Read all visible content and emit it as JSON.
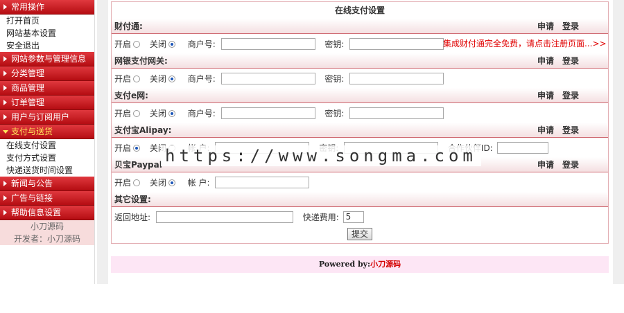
{
  "sidebar": {
    "groups": [
      {
        "label": "常用操作",
        "items": [
          "打开首页",
          "网站基本设置",
          "安全退出"
        ]
      },
      {
        "label": "网站参数与管理信息",
        "items": []
      },
      {
        "label": "分类管理",
        "items": []
      },
      {
        "label": "商品管理",
        "items": []
      },
      {
        "label": "订单管理",
        "items": []
      },
      {
        "label": "用户与订阅用户",
        "items": []
      },
      {
        "label": "支付与送货",
        "items": [
          "在线支付设置",
          "支付方式设置",
          "快递送货时间设置"
        ]
      },
      {
        "label": "新闻与公告",
        "items": []
      },
      {
        "label": "广告与链接",
        "items": []
      },
      {
        "label": "帮助信息设置",
        "items": []
      }
    ],
    "credit_line1": "小刀源码",
    "credit_line2": "开发者：小刀源码"
  },
  "scroll_arrows": [
    "↑",
    "↓",
    "←",
    "→"
  ],
  "page": {
    "title": "在线支付设置",
    "apply": "申请",
    "login": "登录",
    "on": "开启",
    "off": "关闭",
    "merchant_no": "商户号:",
    "key": "密钥:",
    "account": "帐  户:",
    "partner_id": "合作伙伴ID:",
    "tenpay": {
      "title": "财付通:",
      "promo": "集成财付通完全免费，请点击注册页面...>>"
    },
    "chinabank": {
      "title": "网银支付网关:"
    },
    "epay": {
      "title": "支付e网:"
    },
    "alipay": {
      "title": "支付宝Alipay:"
    },
    "paypal": {
      "title": "贝宝Paypal"
    },
    "other": {
      "title": "其它设置:",
      "return_label": "返回地址:",
      "express_label": "快递费用:",
      "express_value": "5"
    },
    "submit": "提交"
  },
  "footer": {
    "powered": "Powered by:",
    "brand": "小刀源码"
  },
  "watermark": "https://www.songma.com"
}
